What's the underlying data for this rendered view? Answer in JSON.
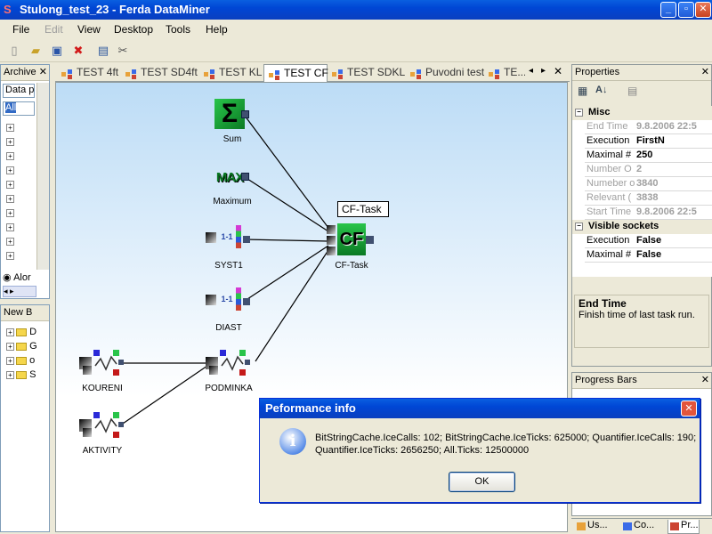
{
  "window": {
    "title": "Stulong_test_23 - Ferda DataMiner",
    "minimize": "_",
    "maximize": "▫",
    "close": "✕"
  },
  "menu": [
    "File",
    "Edit",
    "View",
    "Desktop",
    "Tools",
    "Help"
  ],
  "toolbar": [
    "new-icon",
    "open-icon",
    "save-icon",
    "delete-icon",
    "window-icon",
    "tools-icon"
  ],
  "archive": {
    "title": "Archive",
    "close": "✕",
    "dropdown": "Data p",
    "filter": "All",
    "radio": "Alor"
  },
  "newbox": {
    "title": "New B",
    "rows": [
      "D",
      "G",
      "o",
      "S"
    ]
  },
  "tabs": [
    "TEST 4ft",
    "TEST SD4ft",
    "TEST KL",
    "TEST CF",
    "TEST SDKL",
    "Puvodni test",
    "TE..."
  ],
  "active_tab": "TEST CF",
  "canvas": {
    "nodes": [
      {
        "id": "sum",
        "label": "Sum",
        "glyph": "Σ"
      },
      {
        "id": "max",
        "label": "Maximum",
        "glyph": "MAX"
      },
      {
        "id": "syst1",
        "label": "SYST1",
        "glyph": "1-1"
      },
      {
        "id": "diast",
        "label": "DIAST",
        "glyph": "1-1"
      },
      {
        "id": "cftask",
        "label": "CF-Task",
        "glyph": "CF"
      },
      {
        "id": "koureni",
        "label": "KOURENI"
      },
      {
        "id": "podminka",
        "label": "PODMINKA"
      },
      {
        "id": "aktivity",
        "label": "AKTIVITY"
      }
    ],
    "tooltip": "CF-Task"
  },
  "properties": {
    "title": "Properties",
    "close": "✕",
    "categories": [
      {
        "name": "Misc",
        "rows": [
          {
            "key": "End Time",
            "value": "9.8.2006 22:5",
            "readonly": true
          },
          {
            "key": "Execution",
            "value": "FirstN",
            "readonly": false
          },
          {
            "key": "Maximal #",
            "value": "250",
            "readonly": false
          },
          {
            "key": "Number O",
            "value": "2",
            "readonly": true
          },
          {
            "key": "Numeber o",
            "value": "3840",
            "readonly": true
          },
          {
            "key": "Relevant (",
            "value": "3838",
            "readonly": true
          },
          {
            "key": "Start Time",
            "value": "9.8.2006 22:5",
            "readonly": true
          }
        ]
      },
      {
        "name": "Visible sockets",
        "rows": [
          {
            "key": "Execution",
            "value": "False",
            "readonly": false
          },
          {
            "key": "Maximal #",
            "value": "False",
            "readonly": false
          }
        ]
      }
    ],
    "description_title": "End Time",
    "description_text": "Finish time of last task run."
  },
  "progress": {
    "title": "Progress Bars",
    "close": "✕"
  },
  "bottom_tabs": [
    "Us...",
    "Co...",
    "Pr..."
  ],
  "dialog": {
    "title": "Peformance info",
    "close": "✕",
    "message": "BitStringCache.IceCalls: 102; BitStringCache.IceTicks: 625000; Quantifier.IceCalls: 190; Quantifier.IceTicks: 2656250; All.Ticks: 12500000",
    "ok": "OK",
    "icon": "info-icon"
  }
}
